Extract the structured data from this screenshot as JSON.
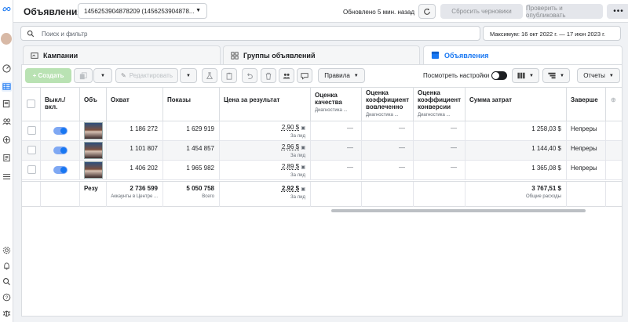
{
  "app": {
    "title": "Объявления",
    "account_selector": "1456253904878209 (1456253904878...",
    "updated_text": "Обновлено 5 мин. назад",
    "discard_drafts_label": "Сбросить черновики",
    "review_publish_label": "Проверить и опубликовать",
    "more_label": "•••"
  },
  "search": {
    "placeholder": "Поиск и фильтр"
  },
  "date_range": "Максимум: 16 окт 2022 г. — 17 июн 2023 г.",
  "tabs": [
    {
      "label": "Кампании"
    },
    {
      "label": "Группы объявлений"
    },
    {
      "label": "Объявления"
    }
  ],
  "toolbar": {
    "create_label": "+ Создать",
    "edit_label": "Редактировать",
    "rules_label": "Правила",
    "view_settings_label": "Посмотреть настройки",
    "reports_label": "Отчеты"
  },
  "table": {
    "headers": {
      "onoff": "Выкл./вкл.",
      "ad": "Объ",
      "reach": "Охват",
      "impressions": "Показы",
      "cpr": "Цена за результат",
      "quality": "Оценка качества",
      "quality_sub": "Диагностика ...",
      "engagement": "Оценка коэффициент вовлеченно",
      "engagement_sub": "Диагностика ...",
      "conversion": "Оценка коэффициент конверсии",
      "conversion_sub": "Диагностика ...",
      "spend": "Сумма затрат",
      "ends": "Заверше"
    },
    "rows": [
      {
        "reach": "1 186 272",
        "impressions": "1 629 919",
        "cpr": "2,90 $",
        "cpr_sub": "За лид",
        "quality": "—",
        "engagement": "—",
        "conversion": "—",
        "spend": "1 258,03 $",
        "ends": "Непреры"
      },
      {
        "reach": "1 101 807",
        "impressions": "1 454 857",
        "cpr": "2,96 $",
        "cpr_sub": "За лид",
        "quality": "—",
        "engagement": "—",
        "conversion": "—",
        "spend": "1 144,40 $",
        "ends": "Непреры"
      },
      {
        "reach": "1 406 202",
        "impressions": "1 965 982",
        "cpr": "2,89 $",
        "cpr_sub": "За лид",
        "quality": "—",
        "engagement": "—",
        "conversion": "—",
        "spend": "1 365,08 $",
        "ends": "Непреры"
      }
    ],
    "totals": {
      "label": "Резу",
      "reach": "2 736 599",
      "reach_sub": "Аккаунты в Центре ...",
      "impressions": "5 050 758",
      "impressions_sub": "Всего",
      "cpr": "2,92 $",
      "cpr_sub": "За лид",
      "spend": "3 767,51 $",
      "spend_sub": "Общие расходы"
    }
  },
  "colors": {
    "accent": "#1877f2",
    "create_button": "#b9e2b3"
  }
}
